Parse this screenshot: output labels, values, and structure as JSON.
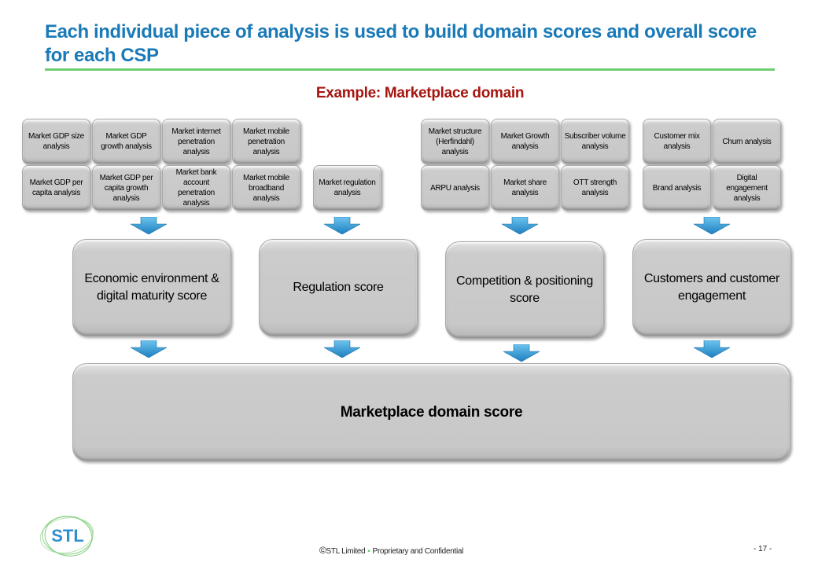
{
  "slide": {
    "title": "Each individual piece of analysis is used to build domain scores and overall score for each CSP",
    "subtitle": "Example:  Marketplace domain",
    "accent_colors": {
      "title": "#1a7ab8",
      "rule": "#6dce72",
      "subtitle": "#a5150f",
      "arrow": "#3a9fd6",
      "box": "#c8c8c8"
    }
  },
  "analysis_groups": [
    {
      "name": "economic",
      "items": [
        "Market GDP size analysis",
        "Market GDP growth analysis",
        "Market internet penetration analysis",
        "Market mobile penetration analysis",
        "Market GDP per capita analysis",
        "Market GDP per capita growth analysis",
        "Market bank account penetration analysis",
        "Market mobile broadband analysis"
      ]
    },
    {
      "name": "regulation",
      "items": [
        "Market regulation analysis"
      ]
    },
    {
      "name": "competition",
      "items": [
        "Market structure (Herfindahl) analysis",
        "Market Growth analysis",
        "Subscriber volume analysis",
        "ARPU analysis",
        "Market share analysis",
        "OTT strength analysis"
      ]
    },
    {
      "name": "customers",
      "items": [
        "Customer mix analysis",
        "Churn analysis",
        "Brand analysis",
        "Digital engagement analysis"
      ]
    }
  ],
  "domain_scores": [
    "Economic environment & digital maturity score",
    "Regulation score",
    "Competition & positioning score",
    "Customers and customer engagement"
  ],
  "overall_score": "Marketplace domain score",
  "footer": {
    "logo_text": "STL",
    "copyright_symbol": "©",
    "company": "STL Limited",
    "separator": "▪",
    "confidentiality": "Proprietary and Confidential",
    "page_number": "- 17 -"
  }
}
